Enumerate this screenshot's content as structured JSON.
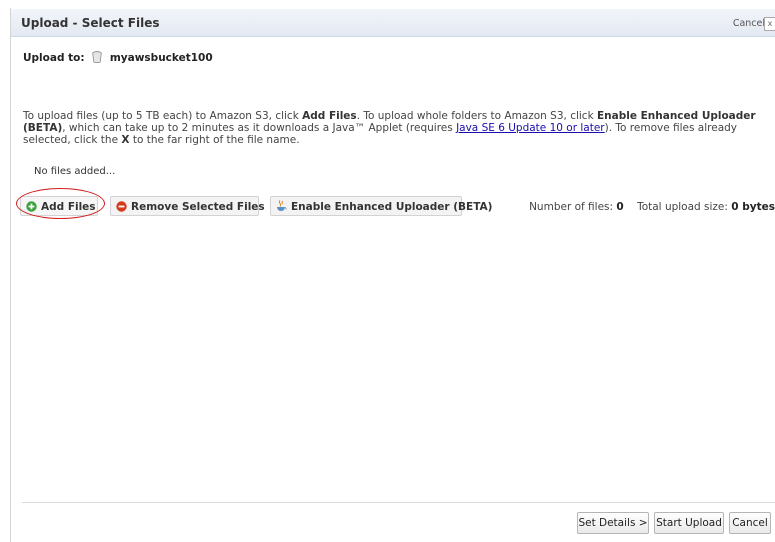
{
  "header": {
    "title": "Upload - Select Files",
    "cancel_link": "Cancel",
    "close_glyph": "x"
  },
  "upload_to": {
    "label": "Upload to:",
    "bucket_name": "myawsbucket100",
    "icon": "bucket-icon"
  },
  "instructions": {
    "part1": "To upload files (up to 5 TB each) to Amazon S3, click ",
    "add_files": "Add Files",
    "part2": ". To upload whole folders to Amazon S3, click ",
    "enable_enhanced": "Enable Enhanced Uploader (BETA)",
    "part3": ", which can take up to 2 minutes as it downloads a Java™ Applet (requires ",
    "java_link": "Java SE 6 Update 10 or later",
    "part4": "). To remove files already selected, click the ",
    "x_label": "X",
    "part5": " to the far right of the file name."
  },
  "file_list": {
    "empty_text": "No files added..."
  },
  "toolbar": {
    "add_files_label": "Add Files",
    "remove_selected_label": "Remove Selected Files",
    "enhanced_uploader_label": "Enable Enhanced Uploader (BETA)",
    "num_files_label": "Number of files:",
    "num_files_value": "0",
    "total_size_label": "Total upload size:",
    "total_size_value": "0 bytes"
  },
  "footer": {
    "set_details_label": "Set Details >",
    "start_upload_label": "Start Upload",
    "cancel_label": "Cancel"
  },
  "colors": {
    "add_icon": "#3aa23a",
    "remove_icon": "#d63a1e",
    "highlight_ring": "#d12020",
    "link": "#1a0dab"
  }
}
